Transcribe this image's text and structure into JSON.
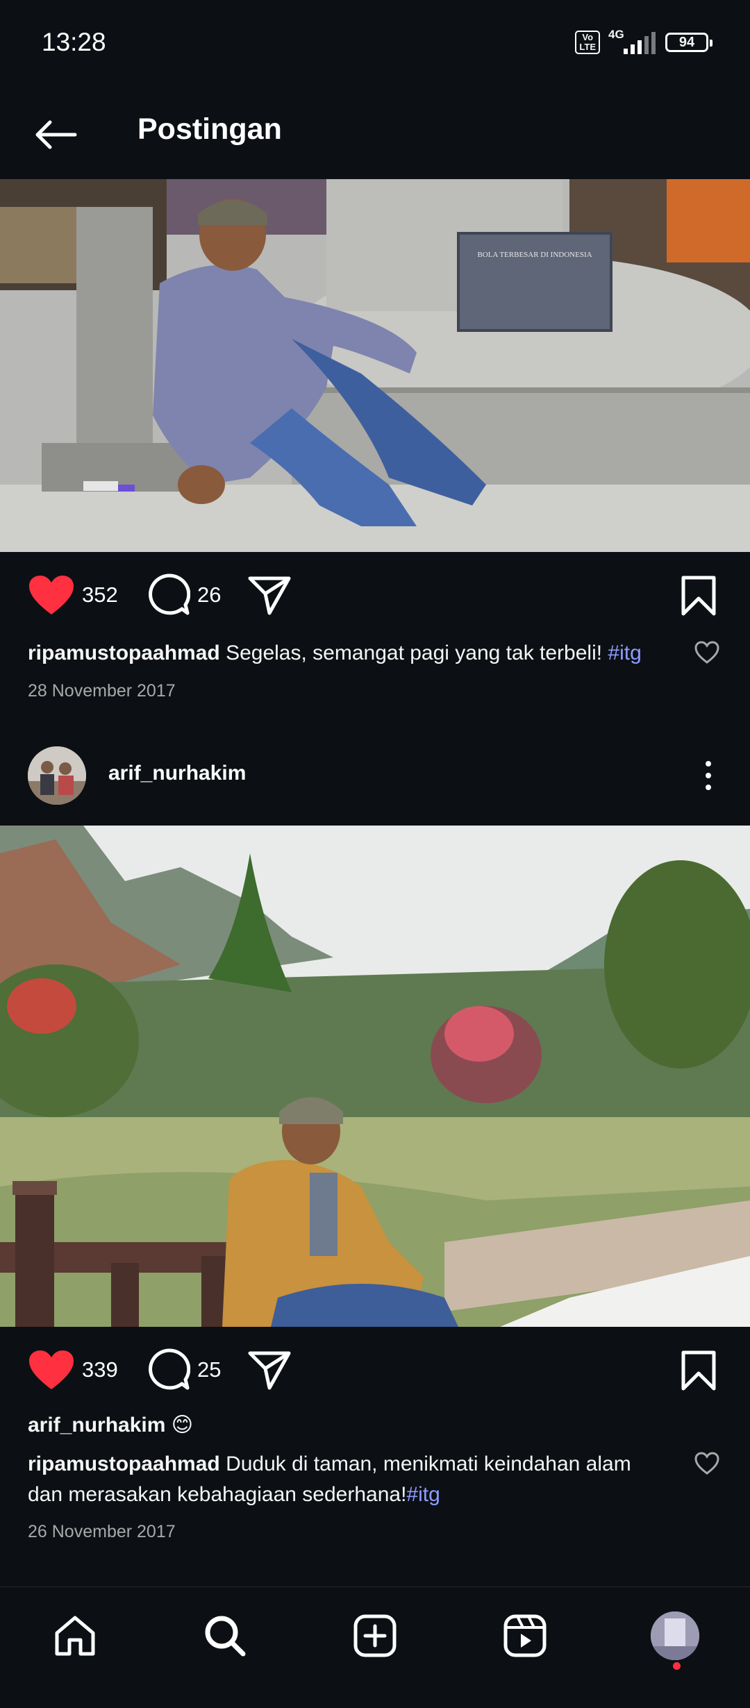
{
  "status_bar": {
    "time": "13:28",
    "volte_top": "Vo",
    "volte_bottom": "LTE",
    "network": "4G",
    "battery": "94"
  },
  "header": {
    "back_icon": "arrow-left-icon",
    "title": "Postingan"
  },
  "posts": [
    {
      "likes": "352",
      "comments": "26",
      "caption_user": "ripamustopaahmad",
      "caption_text": " Segelas, semangat pagi yang tak terbeli! ",
      "caption_tag": "#itg",
      "date": "28 November 2017",
      "photo_sign_text": "BOLA TERBESAR DI INDONESIA"
    },
    {
      "username": "arif_nurhakim",
      "likes": "339",
      "comments": "25",
      "author_line": "arif_nurhakim 😊",
      "caption_user": "ripamustopaahmad",
      "caption_text": " Duduk di taman, menikmati keindahan alam dan merasakan kebahagiaan sederhana!",
      "caption_tag": "#itg",
      "date": "26 November 2017"
    }
  ],
  "nav": [
    "home-icon",
    "search-icon",
    "create-icon",
    "reels-icon",
    "profile-avatar"
  ],
  "colors": {
    "background": "#0c1014",
    "like_red": "#ff3040",
    "hashtag": "#8e9cff",
    "secondary_text": "#a8a8a8"
  }
}
